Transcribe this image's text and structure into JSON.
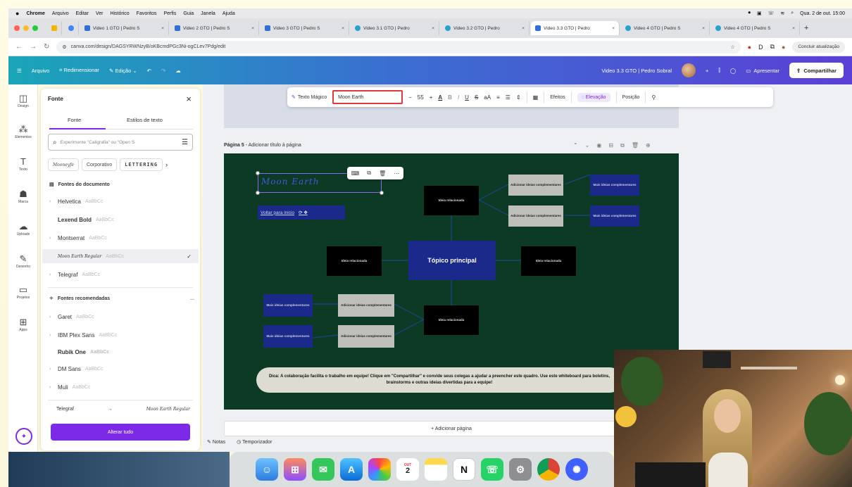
{
  "menubar": {
    "apple": "",
    "items": [
      "Chrome",
      "Arquivo",
      "Editar",
      "Ver",
      "Histórico",
      "Favoritos",
      "Perfis",
      "Guia",
      "Janela",
      "Ajuda"
    ],
    "datetime": "Qua. 2 de out. 15:00"
  },
  "browser": {
    "tabs": [
      {
        "label": "Video 1 GTO | Pedro S",
        "active": false
      },
      {
        "label": "Video 2 GTO | Pedro S",
        "active": false
      },
      {
        "label": "Video 3 GTO | Pedro S",
        "active": false
      },
      {
        "label": "Video 3.1 GTO | Pedro",
        "active": false
      },
      {
        "label": "Video 3.2 GTO | Pedro",
        "active": false
      },
      {
        "label": "Video 3.3 GTO | Pedro",
        "active": true
      },
      {
        "label": "Video 4 GTO | Pedro S",
        "active": false
      },
      {
        "label": "Video 4 GTO | Pedro S",
        "active": false
      }
    ],
    "new_tab": "+",
    "url": "canva.com/design/DAGSYRWNzyB/oKBcmdPGc3Ni-ogCLev7Pdg/edit",
    "update_label": "Concluir atualização"
  },
  "canva_header": {
    "menu_icon": "☰",
    "file": "Arquivo",
    "resize": "Redimensionar",
    "edit": "Edição",
    "doc_title": "Video 3.3 GTO | Pedro Sobral",
    "present": "Apresentar",
    "share": "Compartilhar"
  },
  "rail": [
    {
      "icon": "◫",
      "label": "Design"
    },
    {
      "icon": "⁂",
      "label": "Elementos"
    },
    {
      "icon": "T",
      "label": "Texto"
    },
    {
      "icon": "☗",
      "label": "Marca"
    },
    {
      "icon": "☁",
      "label": "Uploads"
    },
    {
      "icon": "✎",
      "label": "Desenho"
    },
    {
      "icon": "▭",
      "label": "Projetos"
    },
    {
      "icon": "⊞",
      "label": "Apps"
    }
  ],
  "font_panel": {
    "title": "Fonte",
    "tabs": [
      "Fonte",
      "Estilos de texto"
    ],
    "search_placeholder": "Experimente \"Caligrafia\" ou \"Open S",
    "chips": [
      "Mooneyfe",
      "Corporativo",
      "LETTERING"
    ],
    "doc_fonts_heading": "Fontes do documento",
    "doc_fonts": [
      {
        "name": "Helvetica",
        "sample": "AaBbCc",
        "chevron": true,
        "selected": false
      },
      {
        "name": "Lexend Bold",
        "sample": "AaBbCc",
        "chevron": false,
        "selected": false
      },
      {
        "name": "Montserrat",
        "sample": "AaBbCc",
        "chevron": true,
        "selected": false
      },
      {
        "name": "Moon Earth Regular",
        "sample": "AaBbCc",
        "chevron": false,
        "selected": true
      },
      {
        "name": "Telegraf",
        "sample": "AaBbCc",
        "chevron": true,
        "selected": false
      }
    ],
    "recommended_heading": "Fontes recomendadas",
    "recommended_more": "...",
    "recommended": [
      {
        "name": "Garet",
        "sample": "AaBbCc"
      },
      {
        "name": "IBM Plex Sans",
        "sample": "AaBbCc"
      },
      {
        "name": "Rubik One",
        "sample": "AaBbCc"
      },
      {
        "name": "DM Sans",
        "sample": "AaBbCc"
      },
      {
        "name": "Muli",
        "sample": "AaBbCc"
      }
    ],
    "swap_from": "Telegraf",
    "swap_arrow": "→",
    "swap_to": "Moon Earth Regular",
    "apply_all": "Alterar tudo"
  },
  "toolbar": {
    "magic_text": "Texto Mágico",
    "font": "Moon Earth",
    "minus": "−",
    "size": "55",
    "plus": "+",
    "color_a": "A",
    "bold": "B",
    "italic": "I",
    "underline": "U",
    "strike": "S",
    "case": "aA",
    "effects": "Efeitos",
    "elevation": "Elevação",
    "position": "Posição"
  },
  "page": {
    "label": "Página 5",
    "label_suffix": " - Adicionar título à página",
    "title_text": "Moon Earth",
    "back_button": "Voltar para inicio",
    "main_topic": "Tópico principal",
    "related": "Ideia relacionada",
    "add_ideas": "Adicionar ideias complementares",
    "more_ideas": "Mais ideias complementares",
    "tip": "Dica: A colaboração facilita o trabalho em equipe! Clique em \"Compartilhar\" e convide seus colegas a ajudar a preencher este quadro. Use este whiteboard para boletins, brainstorms e outras ideias divertidas para a equipe!"
  },
  "bottom": {
    "add_page": "+ Adicionar página",
    "notes": "Notas",
    "timer": "Temporizador"
  },
  "dock": {
    "calendar_month": "OUT",
    "calendar_day": "2",
    "notion": "N"
  },
  "colors": {
    "canvas_green": "#0c3a24",
    "accent_purple": "#7d2ae8",
    "node_blue": "#1b2a8a",
    "highlight_red": "#e0383b"
  }
}
